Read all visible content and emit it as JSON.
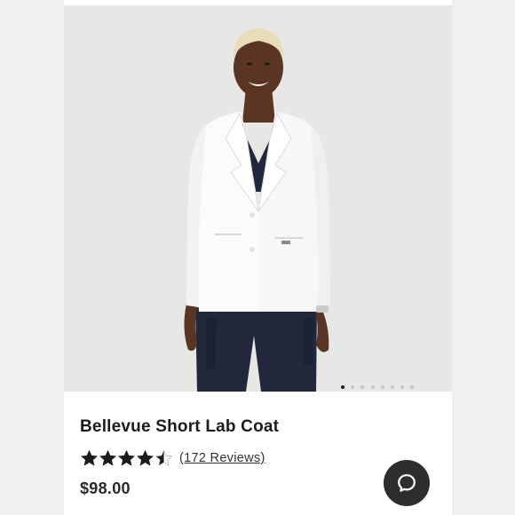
{
  "product": {
    "title": "Bellevue Short Lab Coat",
    "rating": 4.5,
    "reviews_label": "(172 Reviews)",
    "price": "$98.00"
  },
  "gallery": {
    "image_count": 8,
    "active_index": 0
  },
  "icons": {
    "chat": "chat-bubble-icon",
    "star": "star-icon"
  },
  "colors": {
    "background": "#efefef",
    "card": "#ffffff",
    "text": "#1b1b1b",
    "chat_button": "#2e2e2e",
    "active_dot": "#1f1f1f",
    "inactive_dot": "#c6c6c6"
  }
}
